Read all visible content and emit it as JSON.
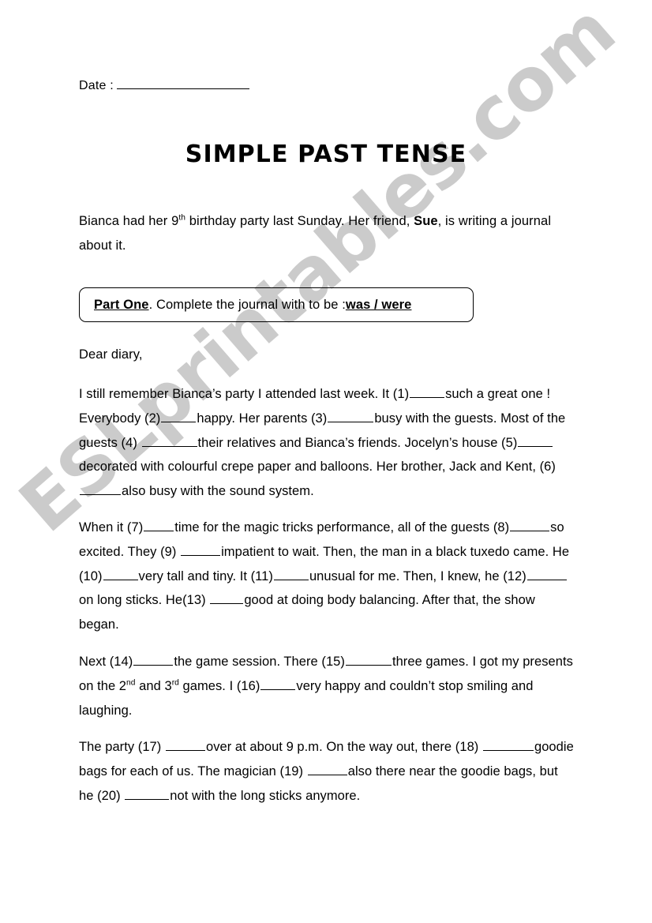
{
  "document": {
    "type": "esl-worksheet",
    "title": "SIMPLE PAST TENSE",
    "date_label": "Date :",
    "watermark": "ESLprintables.com",
    "watermark_color": "#cbcbcb",
    "ink_color": "#000000",
    "page_background": "#ffffff"
  },
  "intro": {
    "before_ordinal": "Bianca had her 9",
    "ordinal_suffix": "th",
    "after_ordinal": " birthday party last Sunday. Her friend, ",
    "bold_name": "Sue",
    "tail": ", is writing a journal about it."
  },
  "instruction": {
    "part_label": "Part One",
    "middle": ". Complete the journal with to be :",
    "answer_options": "was /  were"
  },
  "journal": {
    "salutation": "Dear diary,",
    "paragraphs": [
      {
        "id": "paragraph-1",
        "segments": [
          {
            "text": "I still remember Bianca’s party I attended last week. It (1)"
          },
          {
            "blank": 44
          },
          {
            "text": "such a great one ! Everybody (2)"
          },
          {
            "blank": 44
          },
          {
            "text": "happy. Her parents (3)"
          },
          {
            "blank": 58
          },
          {
            "text": "busy with the guests. Most of the guests (4) "
          },
          {
            "blank": 70
          },
          {
            "text": "their relatives and Bianca’s friends. Jocelyn’s house  (5)"
          },
          {
            "blank": 44
          },
          {
            "text": "decorated with colourful crepe paper and balloons. Her brother, Jack and Kent, (6)"
          },
          {
            "blank": 52
          },
          {
            "text": "also busy with the sound system."
          }
        ]
      },
      {
        "id": "paragraph-2",
        "segments": [
          {
            "text": "When it (7)"
          },
          {
            "blank": 38
          },
          {
            "text": "time for the magic tricks performance, all of the guests (8)"
          },
          {
            "blank": 50
          },
          {
            "text": "so excited. They (9) "
          },
          {
            "blank": 50
          },
          {
            "text": "impatient to wait. Then, the man in a black tuxedo came. He (10)"
          },
          {
            "blank": 44
          },
          {
            "text": "very tall and tiny. It (11)"
          },
          {
            "blank": 44
          },
          {
            "text": "unusual for me. Then, I knew, he (12)"
          },
          {
            "blank": 50
          },
          {
            "text": "on long sticks. He(13) "
          },
          {
            "blank": 42
          },
          {
            "text": "good at doing body balancing. After that, the show began."
          }
        ]
      },
      {
        "id": "paragraph-3",
        "segments": [
          {
            "text": "Next (14)"
          },
          {
            "blank": 50
          },
          {
            "text": "the game session. There  (15)"
          },
          {
            "blank": 58
          },
          {
            "text": "three games. I got my presents on the 2"
          },
          {
            "sup": "nd"
          },
          {
            "text": " and 3"
          },
          {
            "sup": "rd"
          },
          {
            "text": " games. I (16)"
          },
          {
            "blank": 44
          },
          {
            "text": "very happy and couldn’t stop smiling and laughing."
          }
        ]
      },
      {
        "id": "paragraph-4",
        "segments": [
          {
            "text": "The party  (17) "
          },
          {
            "blank": 50
          },
          {
            "text": "over at about 9 p.m. On the way out, there (18) "
          },
          {
            "blank": 64
          },
          {
            "text": "goodie bags for each of us. The magician (19) "
          },
          {
            "blank": 50
          },
          {
            "text": "also there near the goodie bags, but he (20) "
          },
          {
            "blank": 56
          },
          {
            "text": "not  with the long sticks anymore."
          }
        ]
      }
    ]
  }
}
